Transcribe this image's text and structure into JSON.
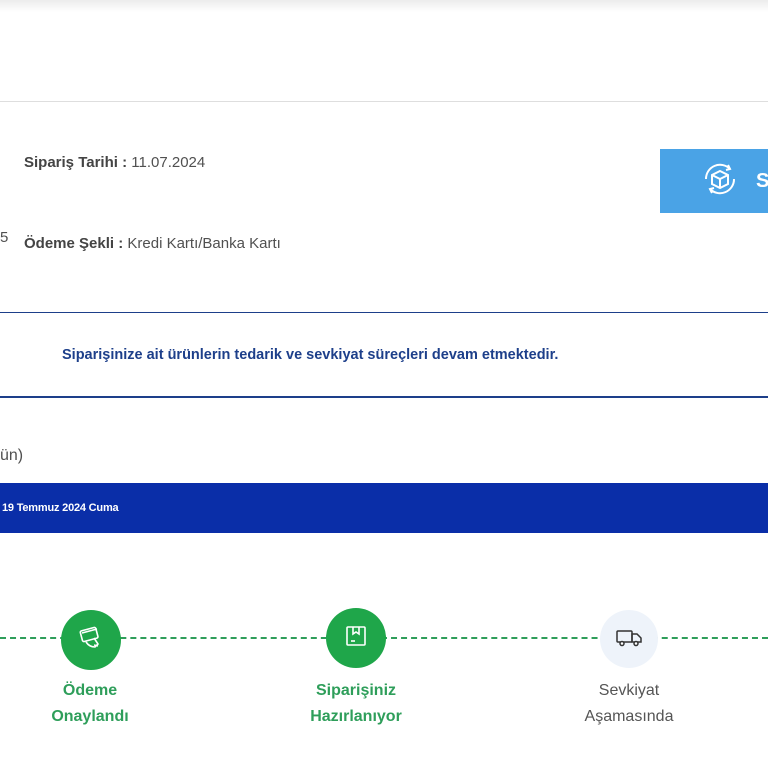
{
  "order": {
    "date_label": "Sipariş Tarihi :",
    "date_value": "11.07.2024",
    "payment_label": "Ödeme Şekli :",
    "payment_value": "Kredi Kartı/Banka Kartı",
    "left_cut_digit": "5"
  },
  "track_button": {
    "label": "S",
    "icon": "package-refresh-icon",
    "color": "#4aa3e6"
  },
  "notice": {
    "text": "Siparişinize ait ürünlerin tedarik ve sevkiyat süreçleri devam etmektedir.",
    "color": "#1d3f8a"
  },
  "left_cut_text": "ün)",
  "delivery_bar": {
    "text": "19 Temmuz 2024 Cuma",
    "color": "#0a2ea8"
  },
  "steps": [
    {
      "label_line1": "Ödeme",
      "label_line2": "Onaylandı",
      "icon": "payment-card-icon",
      "status": "done"
    },
    {
      "label_line1": "Siparişiniz",
      "label_line2": "Hazırlanıyor",
      "icon": "package-box-icon",
      "status": "done"
    },
    {
      "label_line1": "Sevkiyat",
      "label_line2": "Aşamasında",
      "icon": "delivery-truck-icon",
      "status": "pending"
    }
  ],
  "colors": {
    "done": "#1fa64a",
    "pending_bg": "#eef3fa"
  }
}
